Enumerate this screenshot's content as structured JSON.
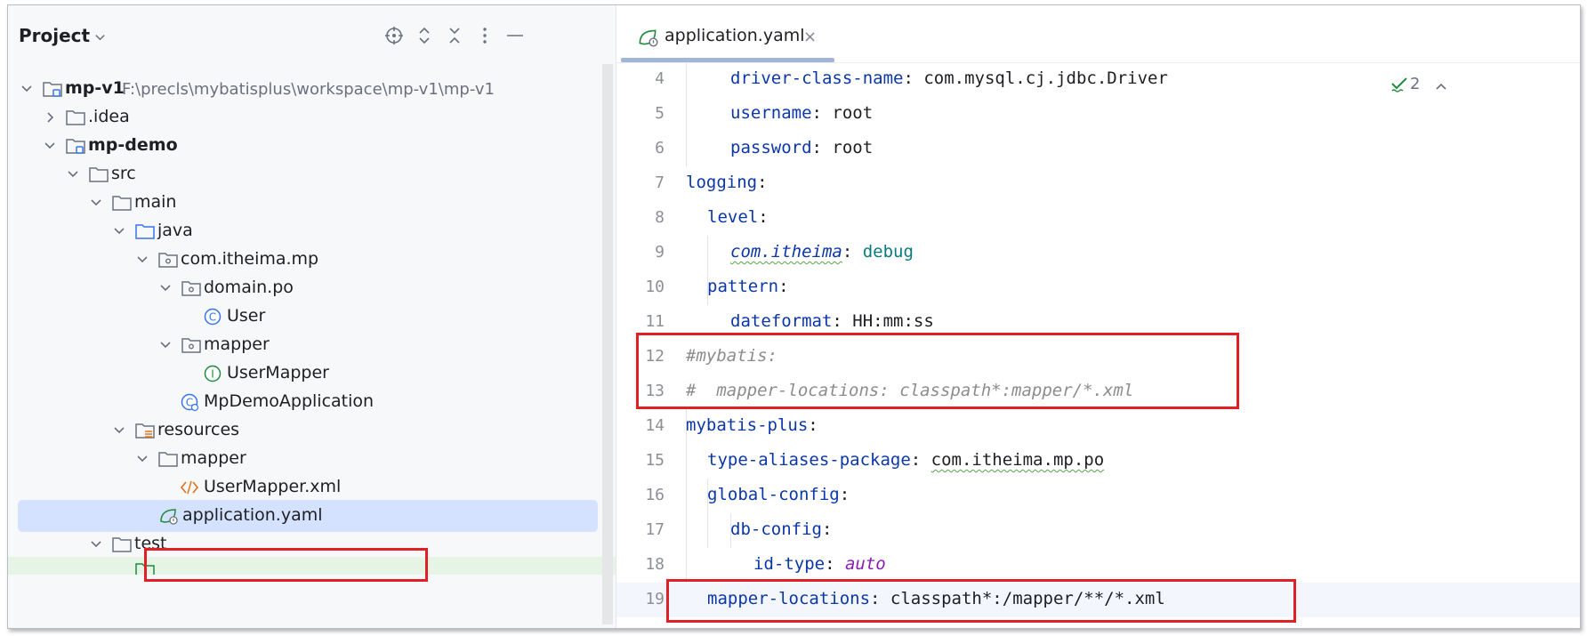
{
  "project": {
    "title": "Project",
    "tree": [
      {
        "label": "mp-v1",
        "path": "F:\\precls\\mybatisplus\\workspace\\mp-v1\\mp-v1",
        "icon": "module-folder-icon",
        "expanded": true
      },
      {
        "label": ".idea",
        "icon": "folder-icon",
        "expanded": false
      },
      {
        "label": "mp-demo",
        "icon": "module-folder-icon",
        "expanded": true
      },
      {
        "label": "src",
        "icon": "folder-icon",
        "expanded": true
      },
      {
        "label": "main",
        "icon": "folder-icon",
        "expanded": true
      },
      {
        "label": "java",
        "icon": "source-folder-icon",
        "expanded": true
      },
      {
        "label": "com.itheima.mp",
        "icon": "package-icon",
        "expanded": true
      },
      {
        "label": "domain.po",
        "icon": "package-icon",
        "expanded": true
      },
      {
        "label": "User",
        "icon": "class-icon"
      },
      {
        "label": "mapper",
        "icon": "package-icon",
        "expanded": true
      },
      {
        "label": "UserMapper",
        "icon": "interface-icon"
      },
      {
        "label": "MpDemoApplication",
        "icon": "spring-boot-class-icon"
      },
      {
        "label": "resources",
        "icon": "resources-folder-icon",
        "expanded": true
      },
      {
        "label": "mapper",
        "icon": "folder-icon",
        "expanded": true
      },
      {
        "label": "UserMapper.xml",
        "icon": "xml-file-icon"
      },
      {
        "label": "application.yaml",
        "icon": "spring-yaml-icon",
        "selected": true
      },
      {
        "label": "test",
        "icon": "folder-icon",
        "expanded": true
      }
    ]
  },
  "editor": {
    "tab": {
      "label": "application.yaml",
      "close": "×"
    },
    "inspection_count": "2",
    "lines": [
      {
        "num": "4",
        "key": "driver-class-name",
        "value": "com.mysql.cj.jdbc.Driver"
      },
      {
        "num": "5",
        "key": "username",
        "value": "root"
      },
      {
        "num": "6",
        "key": "password",
        "value": "root"
      },
      {
        "num": "7",
        "key": "logging",
        "value": ""
      },
      {
        "num": "8",
        "key": "level",
        "value": ""
      },
      {
        "num": "9",
        "key": "com.itheima",
        "value": "debug"
      },
      {
        "num": "10",
        "key": "pattern",
        "value": ""
      },
      {
        "num": "11",
        "key": "dateformat",
        "value": "HH:mm:ss"
      },
      {
        "num": "12",
        "comment": "#mybatis:"
      },
      {
        "num": "13",
        "comment": "#  mapper-locations: classpath*:mapper/*.xml"
      },
      {
        "num": "14",
        "key": "mybatis-plus",
        "value": ""
      },
      {
        "num": "15",
        "key": "type-aliases-package",
        "value": "com.itheima.mp.po"
      },
      {
        "num": "16",
        "key": "global-config",
        "value": ""
      },
      {
        "num": "17",
        "key": "db-config",
        "value": ""
      },
      {
        "num": "18",
        "key": "id-type",
        "value": "auto"
      },
      {
        "num": "19",
        "key": "mapper-locations",
        "value": "classpath*:/mapper/**/*.xml"
      }
    ]
  },
  "colors": {
    "highlight_box": "#e02024",
    "yaml_key": "#0b37a8",
    "selection": "#d4e2ff"
  }
}
